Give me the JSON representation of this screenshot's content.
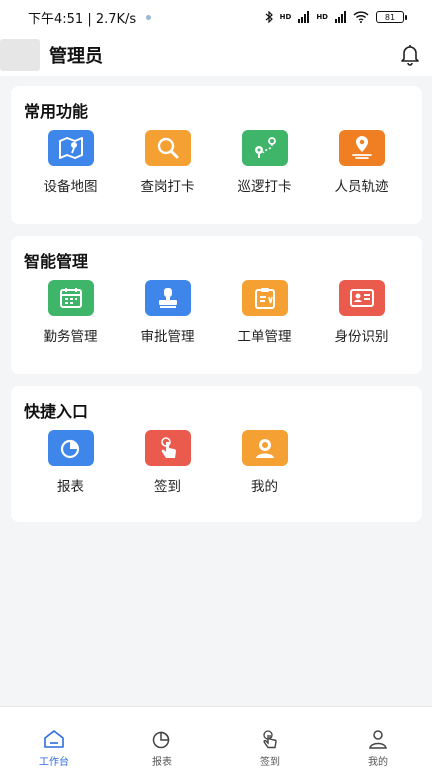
{
  "status": {
    "time_speed": "下午4:51 | 2.7K/s",
    "network_1": "HD",
    "network_2": "HD",
    "battery": "81"
  },
  "header": {
    "title": "管理员",
    "bell_icon": "bell-icon"
  },
  "sections": [
    {
      "title": "常用功能",
      "items": [
        {
          "label": "设备地图",
          "icon": "map-icon",
          "color": "#3f86ea"
        },
        {
          "label": "查岗打卡",
          "icon": "magnifier-icon",
          "color": "#f5a033"
        },
        {
          "label": "巡逻打卡",
          "icon": "route-icon",
          "color": "#3fb56a"
        },
        {
          "label": "人员轨迹",
          "icon": "location-track-icon",
          "color": "#f07e22"
        }
      ]
    },
    {
      "title": "智能管理",
      "items": [
        {
          "label": "勤务管理",
          "icon": "calendar-icon",
          "color": "#3fb56a"
        },
        {
          "label": "审批管理",
          "icon": "stamp-icon",
          "color": "#3f86ea"
        },
        {
          "label": "工单管理",
          "icon": "clipboard-icon",
          "color": "#f5a033"
        },
        {
          "label": "身份识别",
          "icon": "id-card-icon",
          "color": "#ea5a4d"
        }
      ]
    },
    {
      "title": "快捷入口",
      "items": [
        {
          "label": "报表",
          "icon": "pie-chart-icon",
          "color": "#3f86ea"
        },
        {
          "label": "签到",
          "icon": "tap-hand-icon",
          "color": "#ea5a4d"
        },
        {
          "label": "我的",
          "icon": "user-icon",
          "color": "#f5a033"
        }
      ]
    }
  ],
  "bottom_nav": [
    {
      "label": "工作台",
      "icon": "home-icon",
      "active": true
    },
    {
      "label": "报表",
      "icon": "pie-chart-icon",
      "active": false
    },
    {
      "label": "签到",
      "icon": "tap-hand-icon",
      "active": false
    },
    {
      "label": "我的",
      "icon": "user-icon",
      "active": false
    }
  ],
  "colors": {
    "accent": "#2d6be0",
    "background": "#f4f5f7"
  }
}
